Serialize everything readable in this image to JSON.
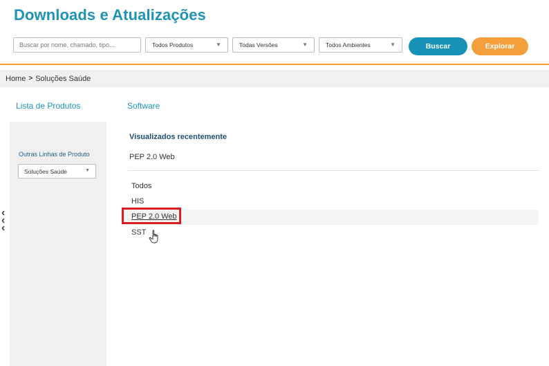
{
  "page": {
    "title": "Downloads e Atualizações"
  },
  "search": {
    "placeholder": "Buscar por nome, chamado, tipo...",
    "products_select": "Todos Produtos",
    "versions_select": "Todas Versões",
    "environments_select": "Todos Ambientes",
    "search_button": "Buscar",
    "explore_button": "Explorar"
  },
  "breadcrumb": {
    "home": "Home",
    "separator": ">",
    "current": "Soluções Saúde"
  },
  "left": {
    "heading": "Lista de Produtos",
    "other_lines_label": "Outras Linhas de Produto",
    "line_select": "Soluções Saúde"
  },
  "main": {
    "heading": "Software",
    "recent_heading": "Visualizados recentemente",
    "recent_items": [
      "PEP 2.0 Web"
    ],
    "items": [
      "Todos",
      "HIS",
      "PEP 2.0 Web",
      "SST"
    ]
  },
  "colors": {
    "brand_blue": "#1f92b5",
    "orange": "#f3a03c",
    "highlight_red": "#d81e1e"
  }
}
